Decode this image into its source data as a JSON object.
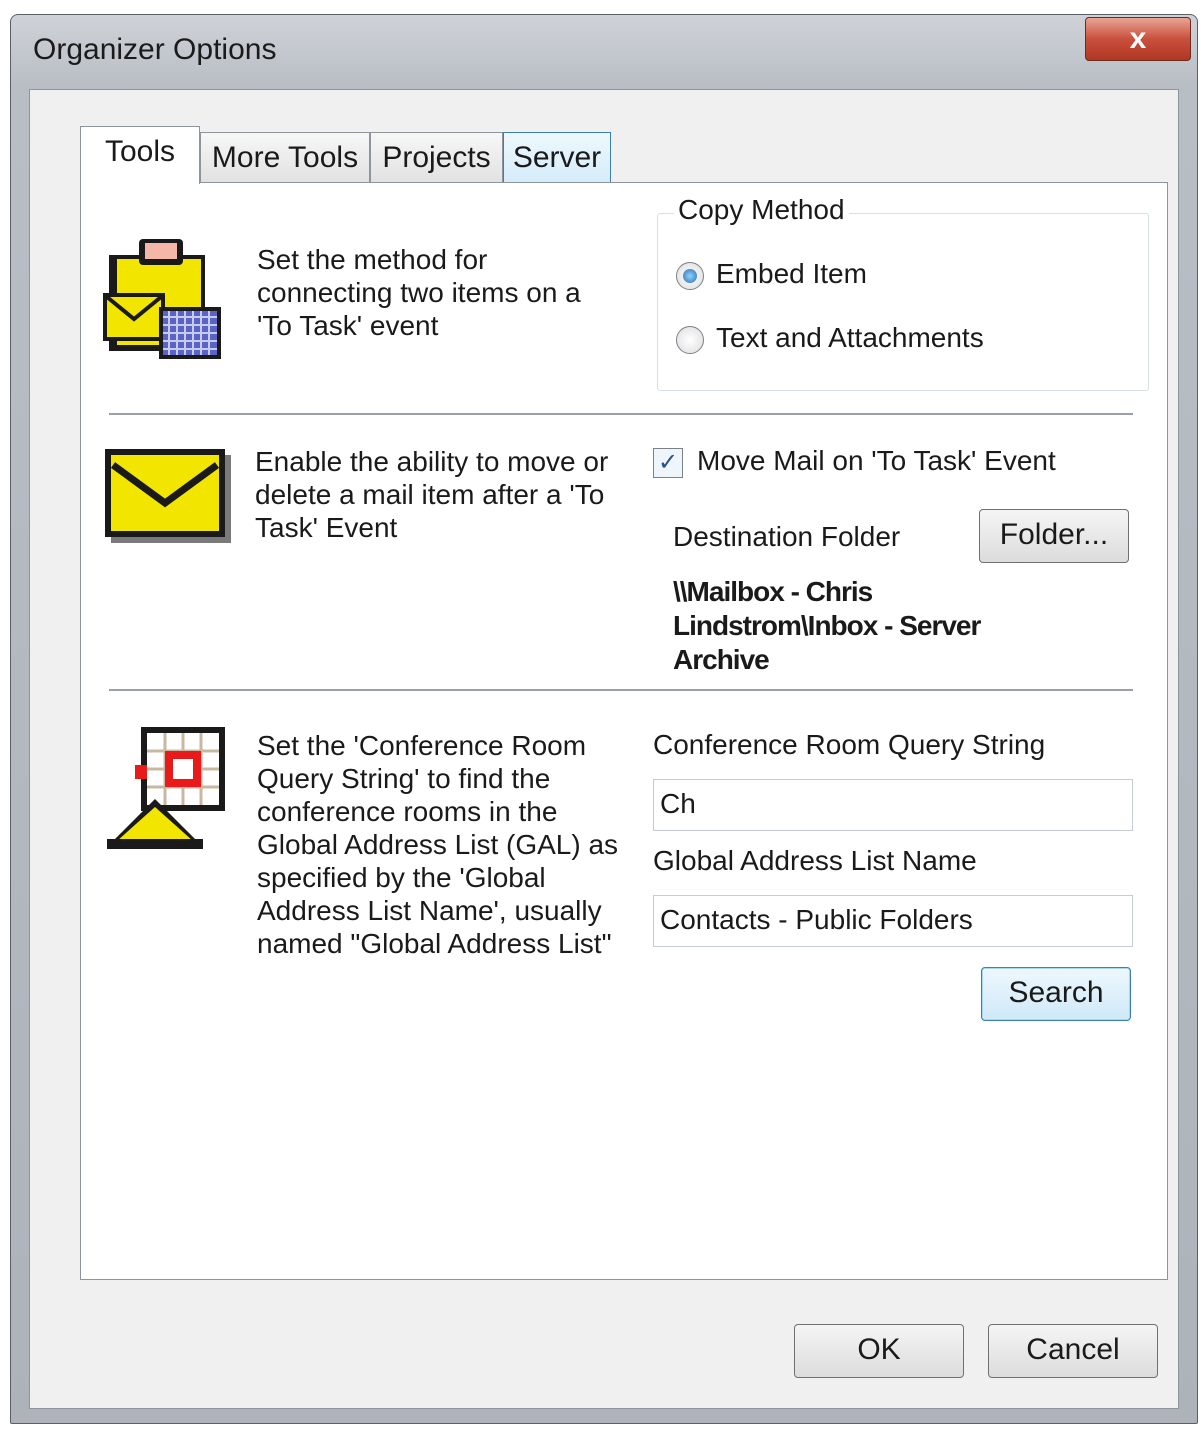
{
  "window": {
    "title": "Organizer Options",
    "close_label": "x"
  },
  "tabs": [
    {
      "label": "Tools"
    },
    {
      "label": "More Tools"
    },
    {
      "label": "Projects"
    },
    {
      "label": "Server"
    }
  ],
  "section1": {
    "description": "Set the method for connecting two items on a 'To Task' event",
    "group_label": "Copy Method",
    "options": [
      {
        "label": "Embed Item",
        "selected": true
      },
      {
        "label": "Text and Attachments",
        "selected": false
      }
    ]
  },
  "section2": {
    "description": "Enable the ability to move or delete a mail item after a 'To Task' Event",
    "checkbox_label": "Move Mail on 'To Task' Event",
    "checked": true,
    "destination_label": "Destination Folder",
    "folder_button": "Folder...",
    "destination_path": "\\\\Mailbox - Chris Lindstrom\\Inbox - Server Archive"
  },
  "section3": {
    "description": "Set the 'Conference Room Query String' to find the conference rooms in the Global Address List (GAL) as specified by the 'Global Address List Name', usually named \"Global Address List\"",
    "query_label": "Conference Room Query String",
    "query_value": "Ch",
    "gal_label": "Global Address List Name",
    "gal_value": "Contacts - Public Folders",
    "search_button": "Search"
  },
  "footer": {
    "ok": "OK",
    "cancel": "Cancel"
  },
  "icons": [
    "task-clipboard-icon",
    "mail-envelope-icon",
    "conference-room-icon"
  ]
}
